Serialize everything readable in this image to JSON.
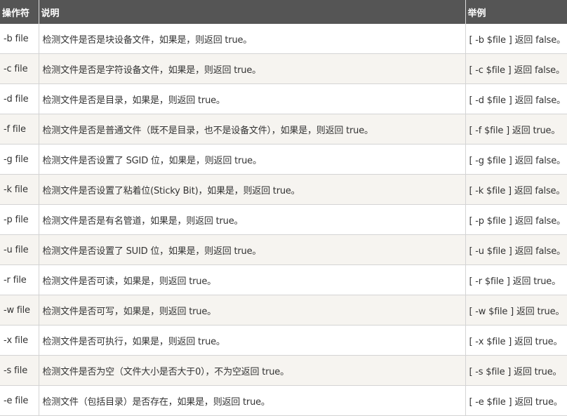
{
  "table": {
    "headers": [
      "操作符",
      "说明",
      "举例"
    ],
    "rows": [
      [
        "-b file",
        "检测文件是否是块设备文件，如果是，则返回 true。",
        "[ -b $file ] 返回 false。"
      ],
      [
        "-c file",
        "检测文件是否是字符设备文件，如果是，则返回 true。",
        "[ -c $file ] 返回 false。"
      ],
      [
        "-d file",
        "检测文件是否是目录，如果是，则返回 true。",
        "[ -d $file ] 返回 false。"
      ],
      [
        "-f file",
        "检测文件是否是普通文件（既不是目录，也不是设备文件），如果是，则返回 true。",
        "[ -f $file ] 返回 true。"
      ],
      [
        "-g file",
        "检测文件是否设置了 SGID 位，如果是，则返回 true。",
        "[ -g $file ] 返回 false。"
      ],
      [
        "-k file",
        "检测文件是否设置了粘着位(Sticky Bit)，如果是，则返回 true。",
        "[ -k $file ] 返回 false。"
      ],
      [
        "-p file",
        "检测文件是否是有名管道，如果是，则返回 true。",
        "[ -p $file ] 返回 false。"
      ],
      [
        "-u file",
        "检测文件是否设置了 SUID 位，如果是，则返回 true。",
        "[ -u $file ] 返回 false。"
      ],
      [
        "-r file",
        "检测文件是否可读，如果是，则返回 true。",
        "[ -r $file ] 返回 true。"
      ],
      [
        "-w file",
        "检测文件是否可写，如果是，则返回 true。",
        "[ -w $file ] 返回 true。"
      ],
      [
        "-x file",
        "检测文件是否可执行，如果是，则返回 true。",
        "[ -x $file ] 返回 true。"
      ],
      [
        "-s file",
        "检测文件是否为空（文件大小是否大于0），不为空返回 true。",
        "[ -s $file ] 返回 true。"
      ],
      [
        "-e file",
        "检测文件（包括目录）是否存在，如果是，则返回 true。",
        "[ -e $file ] 返回 true。"
      ]
    ]
  }
}
